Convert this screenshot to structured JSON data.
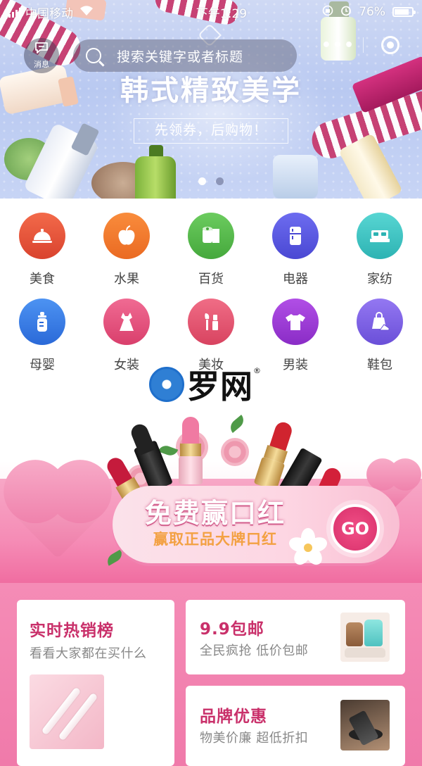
{
  "status_bar": {
    "carrier": "中国移动",
    "time": "下午1:29",
    "battery": "76%"
  },
  "header": {
    "message_label": "消息",
    "search_placeholder": "搜索关键字或者标题",
    "more_icon": "more-dots-icon",
    "close_icon": "target-circle-icon"
  },
  "banner": {
    "slogan": "韩式精致美学",
    "subslogan": "先领券，后购物！",
    "page_count": 2,
    "active_page": 1
  },
  "categories": [
    {
      "label": "美食",
      "icon": "food-cloche-icon",
      "color": "#e9573f"
    },
    {
      "label": "水果",
      "icon": "apple-icon",
      "color": "#f2782d"
    },
    {
      "label": "百货",
      "icon": "toilet-paper-icon",
      "color": "#55b84e"
    },
    {
      "label": "电器",
      "icon": "fridge-icon",
      "color": "#5b5be0"
    },
    {
      "label": "家纺",
      "icon": "bed-icon",
      "color": "#3fc6c6"
    },
    {
      "label": "母婴",
      "icon": "baby-bottle-icon",
      "color": "#3d7ee6"
    },
    {
      "label": "女装",
      "icon": "dress-icon",
      "color": "#e8507d"
    },
    {
      "label": "美妆",
      "icon": "makeup-brush-icon",
      "color": "#ea5272"
    },
    {
      "label": "男装",
      "icon": "tshirt-icon",
      "color": "#9c3ad6"
    },
    {
      "label": "鞋包",
      "icon": "shoe-bag-icon",
      "color": "#7e5fe6"
    }
  ],
  "watermark": {
    "text": "罗网",
    "registered": "®"
  },
  "promo": {
    "title": "免费赢口红",
    "subtitle": "赢取正品大牌口红",
    "go_label": "GO"
  },
  "cards": {
    "hot": {
      "title": "实时热销榜",
      "subtitle": "看看大家都在买什么"
    },
    "deal99": {
      "title": "9.9包邮",
      "subtitle": "全民疯抢 低价包邮"
    },
    "brand": {
      "title": "品牌优惠",
      "subtitle": "物美价廉 超低折扣"
    }
  }
}
